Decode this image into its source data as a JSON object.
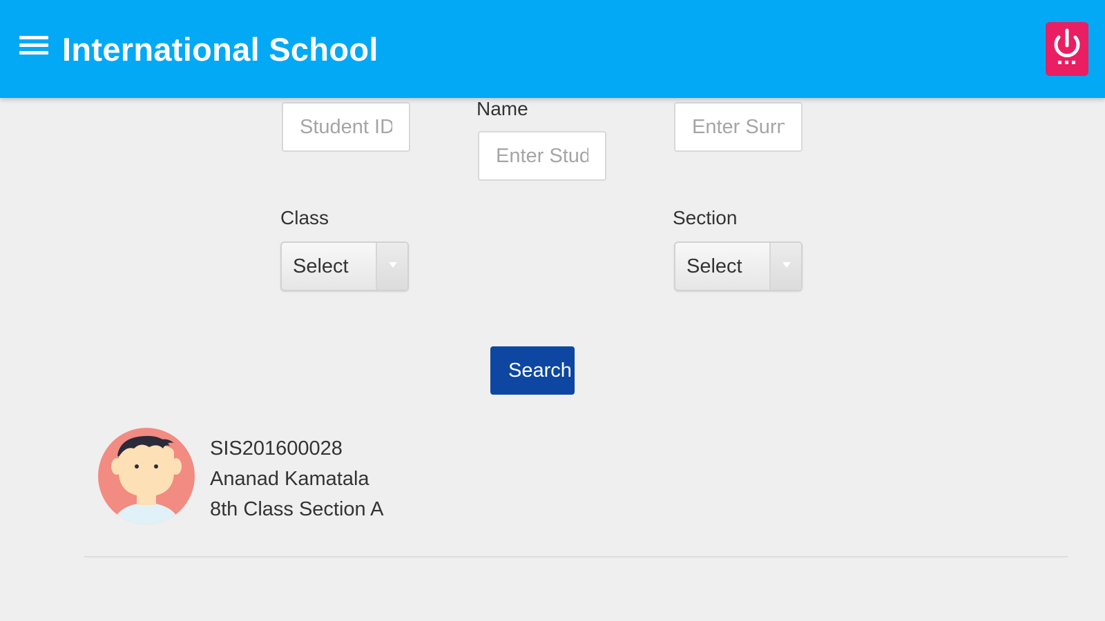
{
  "app_bar": {
    "title": "International School",
    "menu_icon": "menu-icon",
    "power_icon": "power-icon"
  },
  "search_form": {
    "student_id": {
      "placeholder": "Student ID"
    },
    "name": {
      "label": "Name",
      "placeholder": "Enter Student Name"
    },
    "surname": {
      "placeholder": "Enter Surname"
    },
    "class": {
      "label": "Class",
      "value": "Select"
    },
    "section": {
      "label": "Section",
      "value": "Select"
    },
    "search_label": "Search"
  },
  "results": [
    {
      "id": "SIS201600028",
      "name": "Ananad Kamatala",
      "class_section": "8th Class Section A"
    }
  ],
  "colors": {
    "app_bar": "#03a9f4",
    "power_button": "#e91e63",
    "search_button": "#0d47a1",
    "avatar_bg": "#f28b82"
  }
}
